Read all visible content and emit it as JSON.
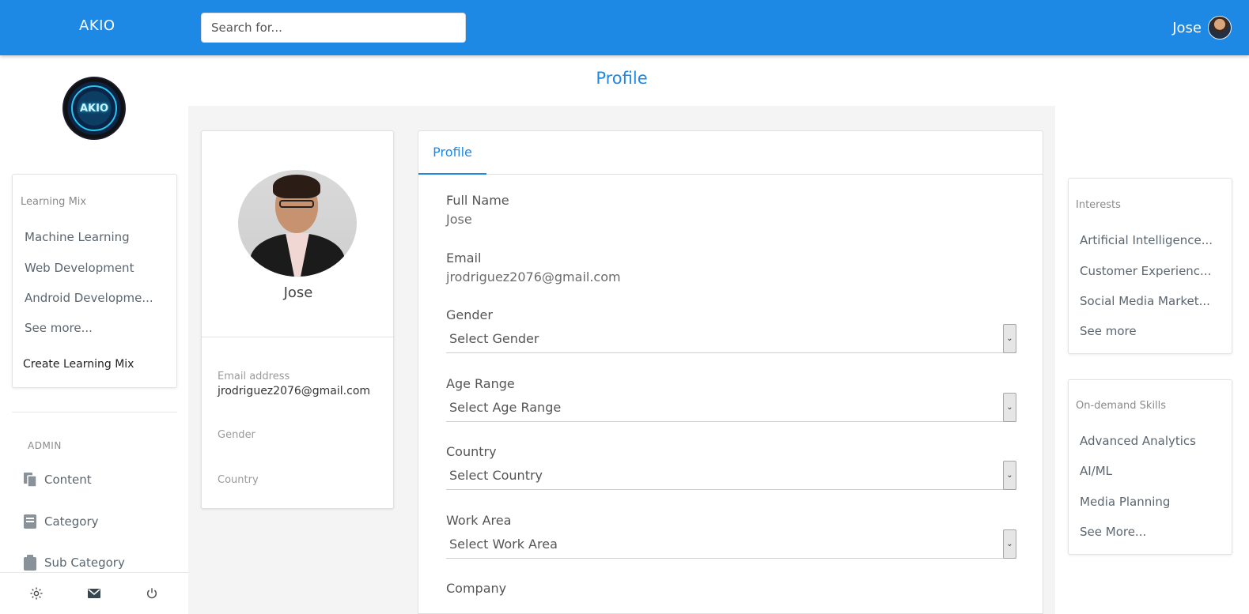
{
  "header": {
    "brand": "AKIO",
    "search_placeholder": "Search for...",
    "user_name": "Jose"
  },
  "sidebar": {
    "logo_text": "AKIO",
    "learning_mix": {
      "title": "Learning Mix",
      "items": [
        "Machine Learning",
        "Web Development",
        "Android Developme...",
        "See more..."
      ],
      "create_label": "Create Learning Mix"
    },
    "admin": {
      "label": "ADMIN",
      "items": [
        {
          "label": "Content",
          "icon": "copy-icon"
        },
        {
          "label": "Category",
          "icon": "book-icon"
        },
        {
          "label": "Sub Category",
          "icon": "clipboard-icon"
        }
      ]
    },
    "footer_icons": [
      "gear-icon",
      "mail-icon",
      "power-icon"
    ]
  },
  "page": {
    "title": "Profile"
  },
  "profile_card": {
    "name": "Jose",
    "email_label": "Email address",
    "email_value": "jrodriguez2076@gmail.com",
    "gender_label": "Gender",
    "country_label": "Country"
  },
  "form": {
    "tab_label": "Profile",
    "full_name_label": "Full Name",
    "full_name_value": "Jose",
    "email_label": "Email",
    "email_value": "jrodriguez2076@gmail.com",
    "gender_label": "Gender",
    "gender_select": "Select Gender",
    "age_label": "Age Range",
    "age_select": "Select Age Range",
    "country_label": "Country",
    "country_select": "Select Country",
    "work_label": "Work Area",
    "work_select": "Select Work Area",
    "company_label": "Company"
  },
  "interests": {
    "title": "Interests",
    "items": [
      "Artificial Intelligence...",
      "Customer Experienc...",
      "Social Media Market...",
      "See more"
    ]
  },
  "skills": {
    "title": "On-demand Skills",
    "items": [
      "Advanced Analytics",
      "AI/ML",
      "Media Planning",
      "See More..."
    ]
  },
  "colors": {
    "accent": "#1e88e5",
    "background": "#f4f4f4"
  }
}
